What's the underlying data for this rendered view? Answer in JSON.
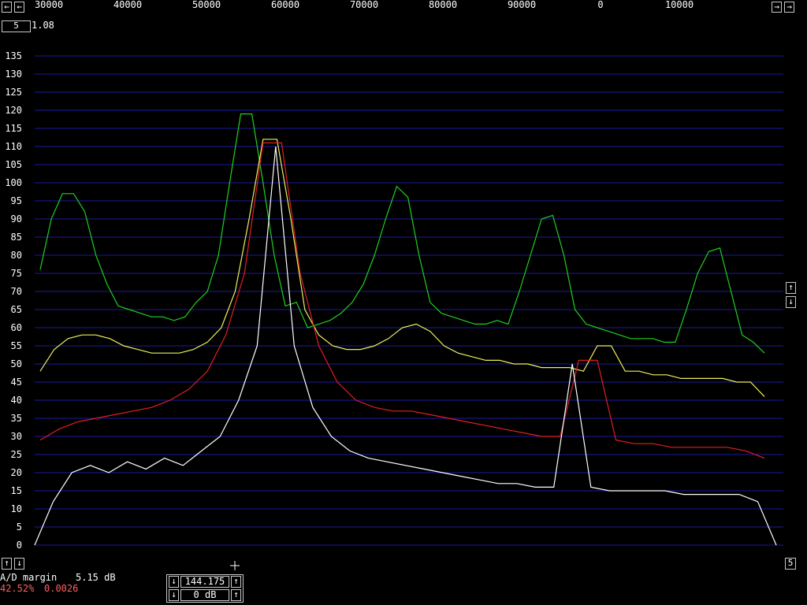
{
  "frequency_scale": {
    "left_arrow": "←",
    "right_arrow": "→",
    "labels": [
      "30000",
      "40000",
      "50000",
      "60000",
      "70000",
      "80000",
      "90000",
      "0",
      "10000"
    ]
  },
  "corner": {
    "box_label": "5",
    "text": "1.08"
  },
  "y_axis": {
    "labels": [
      "135",
      "130",
      "125",
      "120",
      "115",
      "110",
      "105",
      "100",
      "95",
      "90",
      "85",
      "80",
      "75",
      "70",
      "65",
      "60",
      "55",
      "50",
      "45",
      "40",
      "35",
      "30",
      "25",
      "20",
      "15",
      "10",
      "5",
      "0"
    ]
  },
  "side_controls": {
    "up": "↑",
    "down": "↓"
  },
  "bottom_left": {
    "up": "↑",
    "down": "↓"
  },
  "bottom_right_box": "5",
  "status": {
    "ad_margin_label": "A/D margin",
    "ad_margin_value": "5.15 dB",
    "percent": "42.52%",
    "ratio": "0.0026",
    "percent_color": "#ff6060"
  },
  "center_controls": {
    "frequency": "144.175",
    "gain": "0 dB",
    "down_arrow": "↓",
    "up_arrow": "↑"
  },
  "colors": {
    "grid": "#1a1aa0",
    "green": "#20d020",
    "yellow": "#f0f060",
    "red": "#e02020",
    "white": "#ffffff"
  },
  "chart_data": {
    "type": "line",
    "x_tick_labels": [
      "30000",
      "40000",
      "50000",
      "60000",
      "70000",
      "80000",
      "90000",
      "0",
      "10000"
    ],
    "ylim": [
      0,
      135
    ],
    "y_ticks": [
      0,
      5,
      10,
      15,
      20,
      25,
      30,
      35,
      40,
      45,
      50,
      55,
      60,
      65,
      70,
      75,
      80,
      85,
      90,
      95,
      100,
      105,
      110,
      115,
      120,
      125,
      130,
      135
    ],
    "grid": true,
    "series": [
      {
        "color": "green",
        "points": [
          [
            0,
            76
          ],
          [
            1,
            90
          ],
          [
            2,
            97
          ],
          [
            3,
            97
          ],
          [
            4,
            92
          ],
          [
            5,
            80
          ],
          [
            6,
            72
          ],
          [
            7,
            66
          ],
          [
            8,
            65
          ],
          [
            9,
            64
          ],
          [
            10,
            63
          ],
          [
            11,
            63
          ],
          [
            12,
            62
          ],
          [
            13,
            63
          ],
          [
            14,
            67
          ],
          [
            15,
            70
          ],
          [
            16,
            80
          ],
          [
            17,
            100
          ],
          [
            18,
            119
          ],
          [
            19,
            119
          ],
          [
            20,
            100
          ],
          [
            21,
            80
          ],
          [
            22,
            66
          ],
          [
            23,
            67
          ],
          [
            24,
            60
          ],
          [
            25,
            61
          ],
          [
            26,
            62
          ],
          [
            27,
            64
          ],
          [
            28,
            67
          ],
          [
            29,
            72
          ],
          [
            30,
            80
          ],
          [
            31,
            90
          ],
          [
            32,
            99
          ],
          [
            33,
            96
          ],
          [
            34,
            80
          ],
          [
            35,
            67
          ],
          [
            36,
            64
          ],
          [
            37,
            63
          ],
          [
            38,
            62
          ],
          [
            39,
            61
          ],
          [
            40,
            61
          ],
          [
            41,
            62
          ],
          [
            42,
            61
          ],
          [
            43,
            70
          ],
          [
            44,
            80
          ],
          [
            45,
            90
          ],
          [
            46,
            91
          ],
          [
            47,
            80
          ],
          [
            48,
            65
          ],
          [
            49,
            61
          ],
          [
            50,
            60
          ],
          [
            51,
            59
          ],
          [
            52,
            58
          ],
          [
            53,
            57
          ],
          [
            54,
            57
          ],
          [
            55,
            57
          ],
          [
            56,
            56
          ],
          [
            57,
            56
          ],
          [
            58,
            65
          ],
          [
            59,
            75
          ],
          [
            60,
            81
          ],
          [
            61,
            82
          ],
          [
            62,
            70
          ],
          [
            63,
            58
          ],
          [
            64,
            56
          ],
          [
            65,
            53
          ]
        ]
      },
      {
        "color": "yellow",
        "points": [
          [
            0,
            48
          ],
          [
            1,
            54
          ],
          [
            2,
            57
          ],
          [
            3,
            58
          ],
          [
            4,
            58
          ],
          [
            5,
            57
          ],
          [
            6,
            55
          ],
          [
            7,
            54
          ],
          [
            8,
            53
          ],
          [
            9,
            53
          ],
          [
            10,
            53
          ],
          [
            11,
            54
          ],
          [
            12,
            56
          ],
          [
            13,
            60
          ],
          [
            14,
            70
          ],
          [
            15,
            90
          ],
          [
            16,
            112
          ],
          [
            17,
            112
          ],
          [
            18,
            90
          ],
          [
            19,
            65
          ],
          [
            20,
            58
          ],
          [
            21,
            55
          ],
          [
            22,
            54
          ],
          [
            23,
            54
          ],
          [
            24,
            55
          ],
          [
            25,
            57
          ],
          [
            26,
            60
          ],
          [
            27,
            61
          ],
          [
            28,
            59
          ],
          [
            29,
            55
          ],
          [
            30,
            53
          ],
          [
            31,
            52
          ],
          [
            32,
            51
          ],
          [
            33,
            51
          ],
          [
            34,
            50
          ],
          [
            35,
            50
          ],
          [
            36,
            49
          ],
          [
            37,
            49
          ],
          [
            38,
            49
          ],
          [
            39,
            48
          ],
          [
            40,
            55
          ],
          [
            41,
            55
          ],
          [
            42,
            48
          ],
          [
            43,
            48
          ],
          [
            44,
            47
          ],
          [
            45,
            47
          ],
          [
            46,
            46
          ],
          [
            47,
            46
          ],
          [
            48,
            46
          ],
          [
            49,
            46
          ],
          [
            50,
            45
          ],
          [
            51,
            45
          ],
          [
            52,
            41
          ]
        ]
      },
      {
        "color": "red",
        "points": [
          [
            0,
            29
          ],
          [
            1,
            32
          ],
          [
            2,
            34
          ],
          [
            3,
            35
          ],
          [
            4,
            36
          ],
          [
            5,
            37
          ],
          [
            6,
            38
          ],
          [
            7,
            40
          ],
          [
            8,
            43
          ],
          [
            9,
            48
          ],
          [
            10,
            58
          ],
          [
            11,
            75
          ],
          [
            12,
            111
          ],
          [
            13,
            111
          ],
          [
            14,
            75
          ],
          [
            15,
            55
          ],
          [
            16,
            45
          ],
          [
            17,
            40
          ],
          [
            18,
            38
          ],
          [
            19,
            37
          ],
          [
            20,
            37
          ],
          [
            21,
            36
          ],
          [
            22,
            35
          ],
          [
            23,
            34
          ],
          [
            24,
            33
          ],
          [
            25,
            32
          ],
          [
            26,
            31
          ],
          [
            27,
            30
          ],
          [
            28,
            30
          ],
          [
            29,
            51
          ],
          [
            30,
            51
          ],
          [
            31,
            29
          ],
          [
            32,
            28
          ],
          [
            33,
            28
          ],
          [
            34,
            27
          ],
          [
            35,
            27
          ],
          [
            36,
            27
          ],
          [
            37,
            27
          ],
          [
            38,
            26
          ],
          [
            39,
            24
          ]
        ]
      },
      {
        "color": "white",
        "points": [
          [
            0,
            0
          ],
          [
            1,
            12
          ],
          [
            2,
            20
          ],
          [
            3,
            22
          ],
          [
            4,
            20
          ],
          [
            5,
            23
          ],
          [
            6,
            21
          ],
          [
            7,
            24
          ],
          [
            8,
            22
          ],
          [
            9,
            26
          ],
          [
            10,
            30
          ],
          [
            11,
            40
          ],
          [
            12,
            55
          ],
          [
            13,
            110
          ],
          [
            14,
            55
          ],
          [
            15,
            38
          ],
          [
            16,
            30
          ],
          [
            17,
            26
          ],
          [
            18,
            24
          ],
          [
            19,
            23
          ],
          [
            20,
            22
          ],
          [
            21,
            21
          ],
          [
            22,
            20
          ],
          [
            23,
            19
          ],
          [
            24,
            18
          ],
          [
            25,
            17
          ],
          [
            26,
            17
          ],
          [
            27,
            16
          ],
          [
            28,
            16
          ],
          [
            29,
            50
          ],
          [
            30,
            16
          ],
          [
            31,
            15
          ],
          [
            32,
            15
          ],
          [
            33,
            15
          ],
          [
            34,
            15
          ],
          [
            35,
            14
          ],
          [
            36,
            14
          ],
          [
            37,
            14
          ],
          [
            38,
            14
          ],
          [
            39,
            12
          ],
          [
            40,
            0
          ]
        ]
      }
    ]
  }
}
